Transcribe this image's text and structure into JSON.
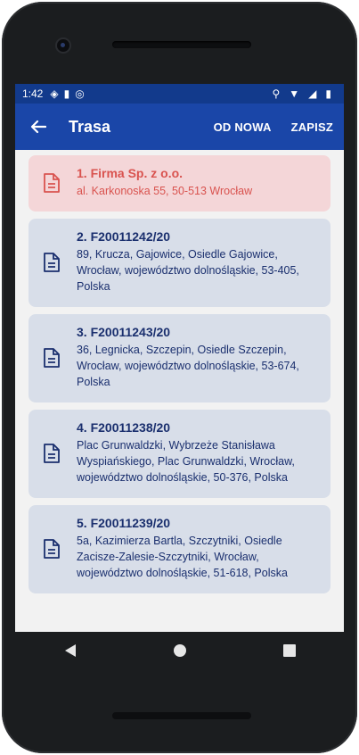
{
  "status_bar": {
    "time": "1:42"
  },
  "app_bar": {
    "title": "Trasa",
    "action_reset": "OD NOWA",
    "action_save": "ZAPISZ"
  },
  "stops": [
    {
      "name": "1. Firma Sp. z o.o.",
      "address": "al. Karkonoska 55, 50-513 Wrocław",
      "highlighted": true
    },
    {
      "name": "2. F20011242/20",
      "address": "89, Krucza, Gajowice, Osiedle Gajowice, Wrocław, województwo dolnośląskie, 53-405, Polska"
    },
    {
      "name": "3. F20011243/20",
      "address": "36, Legnicka, Szczepin, Osiedle Szczepin, Wrocław, województwo dolnośląskie, 53-674, Polska"
    },
    {
      "name": "4. F20011238/20",
      "address": "Plac Grunwaldzki, Wybrzeże Stanisława Wyspiańskiego, Plac Grunwaldzki, Wrocław, województwo dolnośląskie, 50-376, Polska"
    },
    {
      "name": "5. F20011239/20",
      "address": "5a, Kazimierza Bartla, Szczytniki, Osiedle Zacisze-Zalesie-Szczytniki, Wrocław, województwo dolnośląskie, 51-618, Polska"
    }
  ],
  "colors": {
    "appbar": "#1a46a8",
    "statusbar": "#123a8c",
    "card": "#d8dee9",
    "card_highlight": "#f4d6d8",
    "text_primary": "#1a2f6e",
    "text_highlight": "#d9534f"
  },
  "icons": {
    "back": "arrow-left-icon",
    "stop": "document-icon",
    "nav_back": "triangle-back-icon",
    "nav_home": "circle-home-icon",
    "nav_recents": "square-recents-icon"
  }
}
